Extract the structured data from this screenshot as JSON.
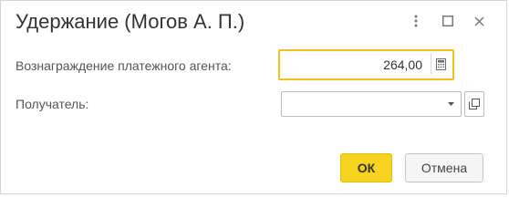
{
  "dialog": {
    "title": "Удержание (Могов А. П.)"
  },
  "fields": {
    "agent_fee": {
      "label": "Вознаграждение платежного агента:",
      "value": "264,00",
      "icon": "calculator-icon"
    },
    "recipient": {
      "label": "Получатель:",
      "value": "",
      "icons": [
        "chevron-down-icon",
        "open-form-icon"
      ]
    }
  },
  "buttons": {
    "ok_label": "ОК",
    "cancel_label": "Отмена"
  },
  "window_controls": [
    "more-vertical-icon",
    "maximize-icon",
    "close-icon"
  ],
  "colors": {
    "accent": "#f7d21f",
    "focus_border": "#f0c419"
  }
}
